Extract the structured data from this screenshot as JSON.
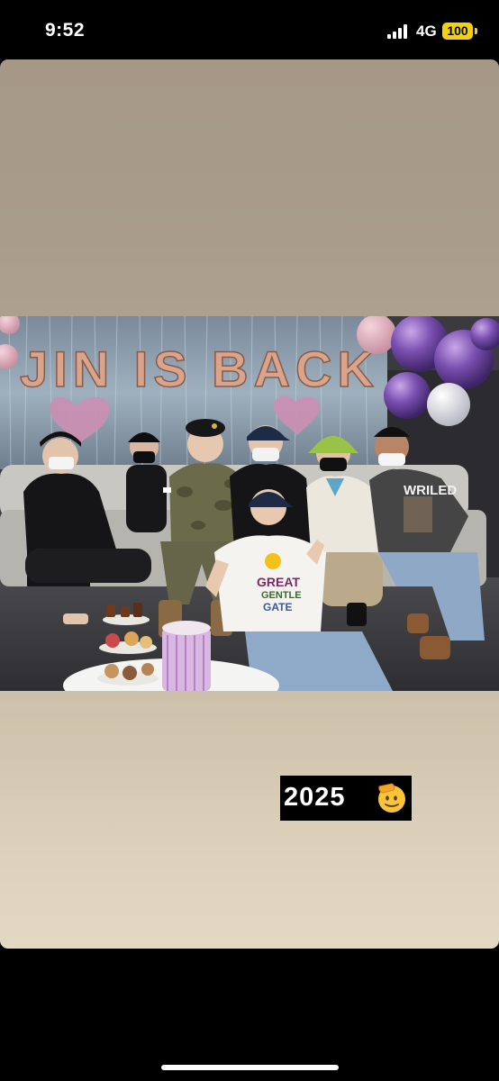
{
  "status_bar": {
    "time": "9:52",
    "network": "4G",
    "battery": "100",
    "battery_color": "#f2d210"
  },
  "story": {
    "photo": {
      "banner_text": "JIN IS BACK",
      "shirt_text_1": "GREAT",
      "shirt_text_2": "GENTLE",
      "shirt_text_3": "GATE",
      "shirt_text_4": "WRILED"
    },
    "sticker": {
      "year": "2025",
      "emoji": "saluting-face-emoji"
    }
  }
}
